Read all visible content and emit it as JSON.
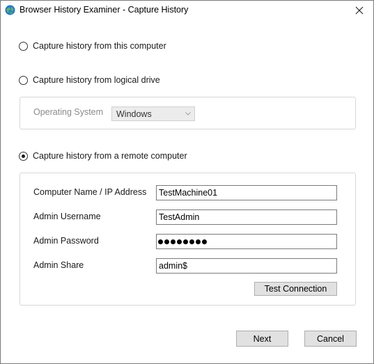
{
  "window": {
    "title": "Browser History Examiner - Capture History"
  },
  "options": {
    "this_computer": {
      "label": "Capture history from this computer",
      "checked": false
    },
    "logical_drive": {
      "label": "Capture history from logical drive",
      "checked": false
    },
    "remote_computer": {
      "label": "Capture history from a remote computer",
      "checked": true
    }
  },
  "logical_drive_group": {
    "os_label": "Operating System",
    "os_value": "Windows"
  },
  "remote_group": {
    "computer_label": "Computer Name / IP Address",
    "computer_value": "TestMachine01",
    "username_label": "Admin Username",
    "username_value": "TestAdmin",
    "password_label": "Admin Password",
    "password_length": 8,
    "share_label": "Admin Share",
    "share_value": "admin$",
    "test_button": "Test Connection"
  },
  "footer": {
    "next_button": "Next",
    "cancel_button": "Cancel"
  },
  "icons": {
    "app": "globe-icon",
    "close": "close-icon",
    "dropdown": "chevron-down-icon"
  },
  "colors": {
    "button_bg": "#e1e1e1",
    "group_border": "#d7d7d7",
    "disabled_text": "#8a8a8a"
  }
}
